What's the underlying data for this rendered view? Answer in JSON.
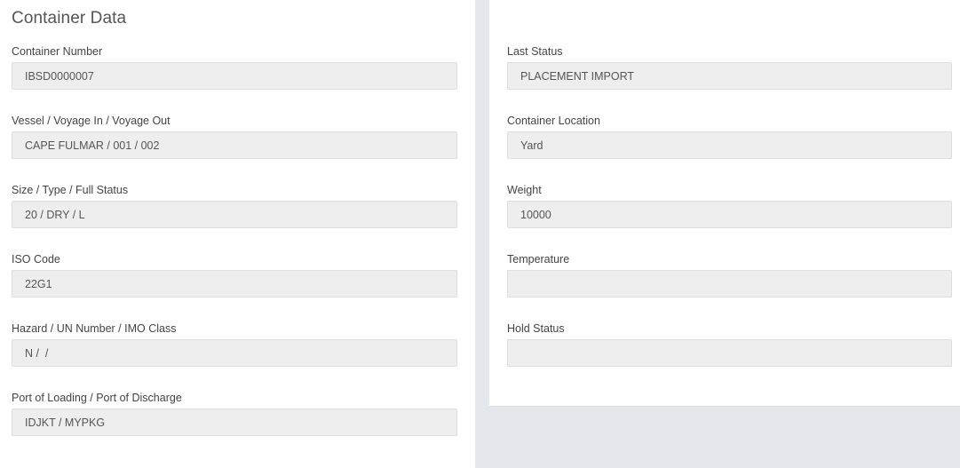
{
  "section": {
    "title": "Container Data"
  },
  "left_fields": [
    {
      "label": "Container Number",
      "value": "IBSD0000007"
    },
    {
      "label": "Vessel / Voyage In / Voyage Out",
      "value": "CAPE FULMAR / 001 / 002"
    },
    {
      "label": "Size / Type / Full Status",
      "value": "20 / DRY / L"
    },
    {
      "label": "ISO Code",
      "value": "22G1"
    },
    {
      "label": "Hazard / UN Number / IMO Class",
      "value": "N /  /"
    },
    {
      "label": "Port of Loading / Port of Discharge",
      "value": "IDJKT / MYPKG"
    }
  ],
  "right_fields": [
    {
      "label": "Last Status",
      "value": "PLACEMENT IMPORT"
    },
    {
      "label": "Container Location",
      "value": "Yard"
    },
    {
      "label": "Weight",
      "value": "10000"
    },
    {
      "label": "Temperature",
      "value": ""
    },
    {
      "label": "Hold Status",
      "value": ""
    }
  ]
}
